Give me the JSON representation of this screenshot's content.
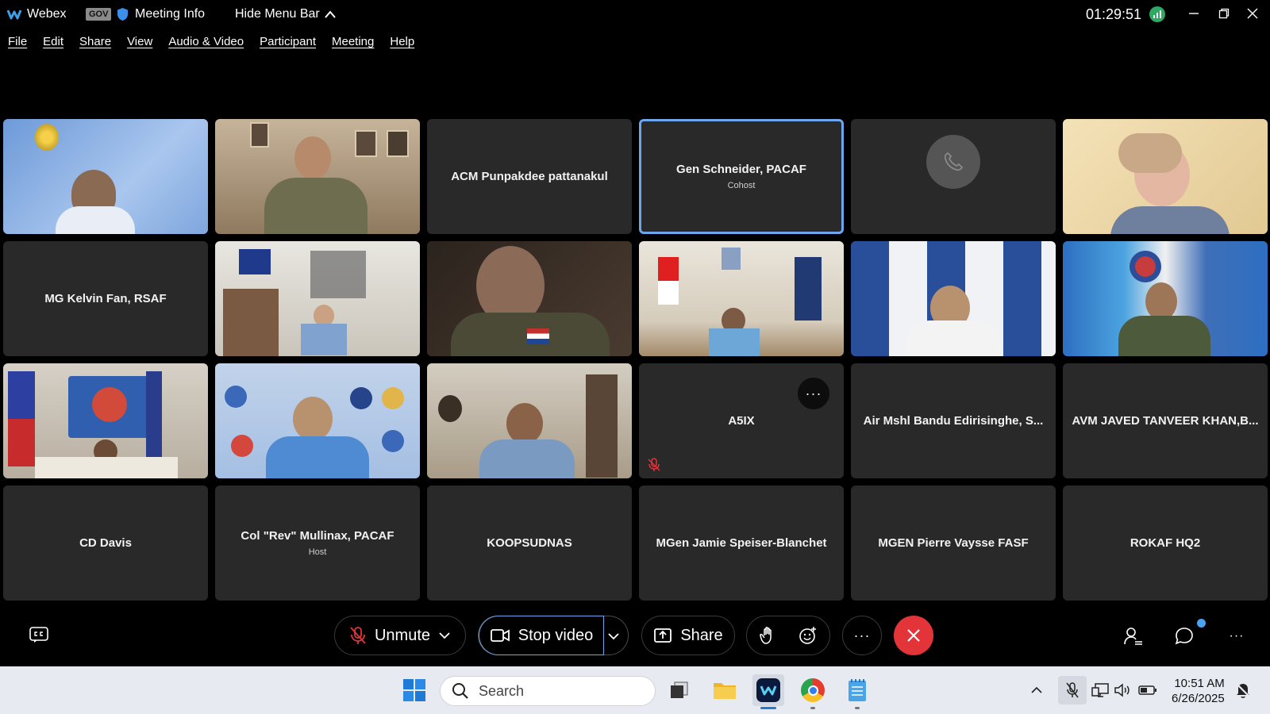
{
  "window": {
    "app_name": "Webex",
    "gov_badge": "GOV",
    "meeting_info_label": "Meeting Info",
    "hide_menu_label": "Hide Menu Bar",
    "timer": "01:29:51"
  },
  "menu": [
    "File",
    "Edit",
    "Share",
    "View",
    "Audio & Video",
    "Participant",
    "Meeting",
    "Help"
  ],
  "tiles": [
    {
      "name": "",
      "role": "",
      "kind": "video"
    },
    {
      "name": "",
      "role": "",
      "kind": "video"
    },
    {
      "name": "ACM Punpakdee pattanakul",
      "role": "",
      "kind": "name"
    },
    {
      "name": "Gen Schneider, PACAF",
      "role": "Cohost",
      "kind": "name"
    },
    {
      "name": "",
      "role": "",
      "kind": "phone"
    },
    {
      "name": "",
      "role": "",
      "kind": "video"
    },
    {
      "name": "MG Kelvin Fan, RSAF",
      "role": "",
      "kind": "name"
    },
    {
      "name": "",
      "role": "",
      "kind": "video"
    },
    {
      "name": "",
      "role": "",
      "kind": "video"
    },
    {
      "name": "",
      "role": "",
      "kind": "video"
    },
    {
      "name": "",
      "role": "",
      "kind": "video"
    },
    {
      "name": "",
      "role": "",
      "kind": "video"
    },
    {
      "name": "",
      "role": "",
      "kind": "video"
    },
    {
      "name": "",
      "role": "",
      "kind": "video"
    },
    {
      "name": "",
      "role": "",
      "kind": "video"
    },
    {
      "name": "A5IX",
      "role": "",
      "kind": "name"
    },
    {
      "name": "Air Mshl Bandu Edirisinghe, S...",
      "role": "",
      "kind": "name"
    },
    {
      "name": "AVM JAVED TANVEER KHAN,B...",
      "role": "",
      "kind": "name"
    },
    {
      "name": "CD Davis",
      "role": "",
      "kind": "name"
    },
    {
      "name": "Col \"Rev\" Mullinax, PACAF",
      "role": "Host",
      "kind": "name"
    },
    {
      "name": "KOOPSUDNAS",
      "role": "",
      "kind": "name"
    },
    {
      "name": "MGen Jamie Speiser-Blanchet",
      "role": "",
      "kind": "name"
    },
    {
      "name": "MGEN Pierre Vaysse FASF",
      "role": "",
      "kind": "name"
    },
    {
      "name": "ROKAF HQ2",
      "role": "",
      "kind": "name"
    }
  ],
  "controls": {
    "unmute_label": "Unmute",
    "stop_video_label": "Stop video",
    "share_label": "Share"
  },
  "taskbar": {
    "search_placeholder": "Search",
    "time": "10:51 AM",
    "date": "6/26/2025"
  },
  "colors": {
    "active_border": "#6ca6ec",
    "end_call": "#e3343a",
    "tile_bg": "#292929"
  }
}
